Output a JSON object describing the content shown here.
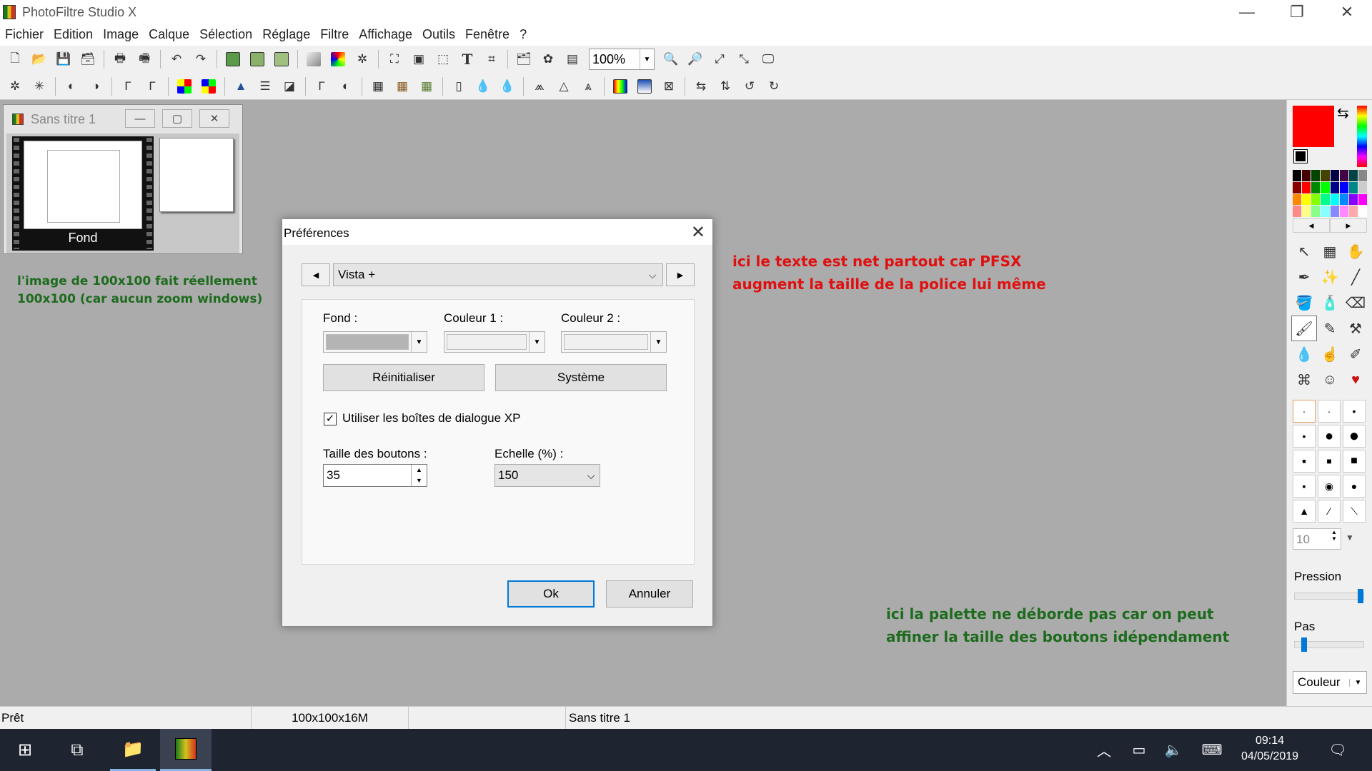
{
  "app": {
    "title": "PhotoFiltre Studio X"
  },
  "window_controls": {
    "minimize": "—",
    "restore": "❐",
    "close": "✕"
  },
  "menu": [
    "Fichier",
    "Edition",
    "Image",
    "Calque",
    "Sélection",
    "Réglage",
    "Filtre",
    "Affichage",
    "Outils",
    "Fenêtre",
    "?"
  ],
  "toolbar": {
    "zoom_value": "100%"
  },
  "document": {
    "title": "Sans titre 1",
    "layer_label": "Fond"
  },
  "notes": {
    "left_line1": "l'image de 100x100 fait réellement",
    "left_line2": "100x100 (car aucun zoom windows)",
    "red_line1": "ici le texte est net partout car PFSX",
    "red_line2": "augment la taille de la police lui même",
    "green_line1": "ici la palette ne déborde pas car on peut",
    "green_line2": "affiner la taille des boutons idépendament"
  },
  "dialog": {
    "title": "Préférences",
    "theme_value": "Vista +",
    "fond_label": "Fond :",
    "color1_label": "Couleur 1 :",
    "color2_label": "Couleur 2 :",
    "reset_label": "Réinitialiser",
    "system_label": "Système",
    "checkbox_label": "Utiliser les boîtes de dialogue XP",
    "checkbox_checked": true,
    "button_size_label": "Taille des boutons :",
    "button_size_value": "35",
    "scale_label": "Echelle (%) :",
    "scale_value": "150",
    "ok_label": "Ok",
    "cancel_label": "Annuler",
    "colors": {
      "fond": "#b4b4b4",
      "color1": "#f0f0f0",
      "color2": "#f0f0f0"
    }
  },
  "right_panel": {
    "fg_color": "#ff0000",
    "bg_color": "#000000",
    "brush_size": "10",
    "pression_label": "Pression",
    "pression_level": 1.0,
    "pas_label": "Pas",
    "pas_level": 0.1,
    "mode_value": "Couleur"
  },
  "status": {
    "ready": "Prêt",
    "dims": "100x100x16M",
    "doc": "Sans titre 1"
  },
  "taskbar": {
    "time": "09:14",
    "date": "04/05/2019"
  }
}
